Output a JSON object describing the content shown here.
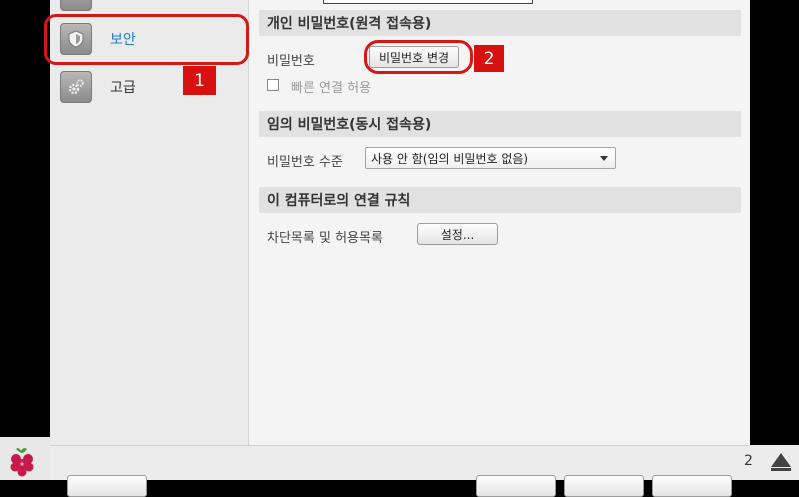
{
  "sidebar": {
    "items": [
      {
        "label": "보안",
        "icon": "shield-icon",
        "selected": true
      },
      {
        "label": "고급",
        "icon": "gears-icon",
        "selected": false
      }
    ]
  },
  "sections": {
    "private_password": {
      "header": "개인 비밀번호(원격 접속용)",
      "password_label": "비밀번호",
      "change_button": "비밀번호 변경",
      "quick_connect_label": "빠른 연결 허용",
      "quick_connect_checked": false
    },
    "temp_password": {
      "header": "임의 비밀번호(동시 접속용)",
      "level_label": "비밀번호 수준",
      "level_value": "사용 안 함(임의 비밀번호 없음)"
    },
    "connection_rules": {
      "header": "이 컴퓨터로의 연결 규칙",
      "list_label": "차단목록 및 허용목록",
      "settings_button": "설정..."
    }
  },
  "annotations": {
    "marker1": "1",
    "marker2": "2",
    "color": "#d41717"
  },
  "taskbar": {
    "stray_char": "2",
    "tray_icon": "up-arrow-icon",
    "start_icon": "raspberry-pi-icon"
  }
}
